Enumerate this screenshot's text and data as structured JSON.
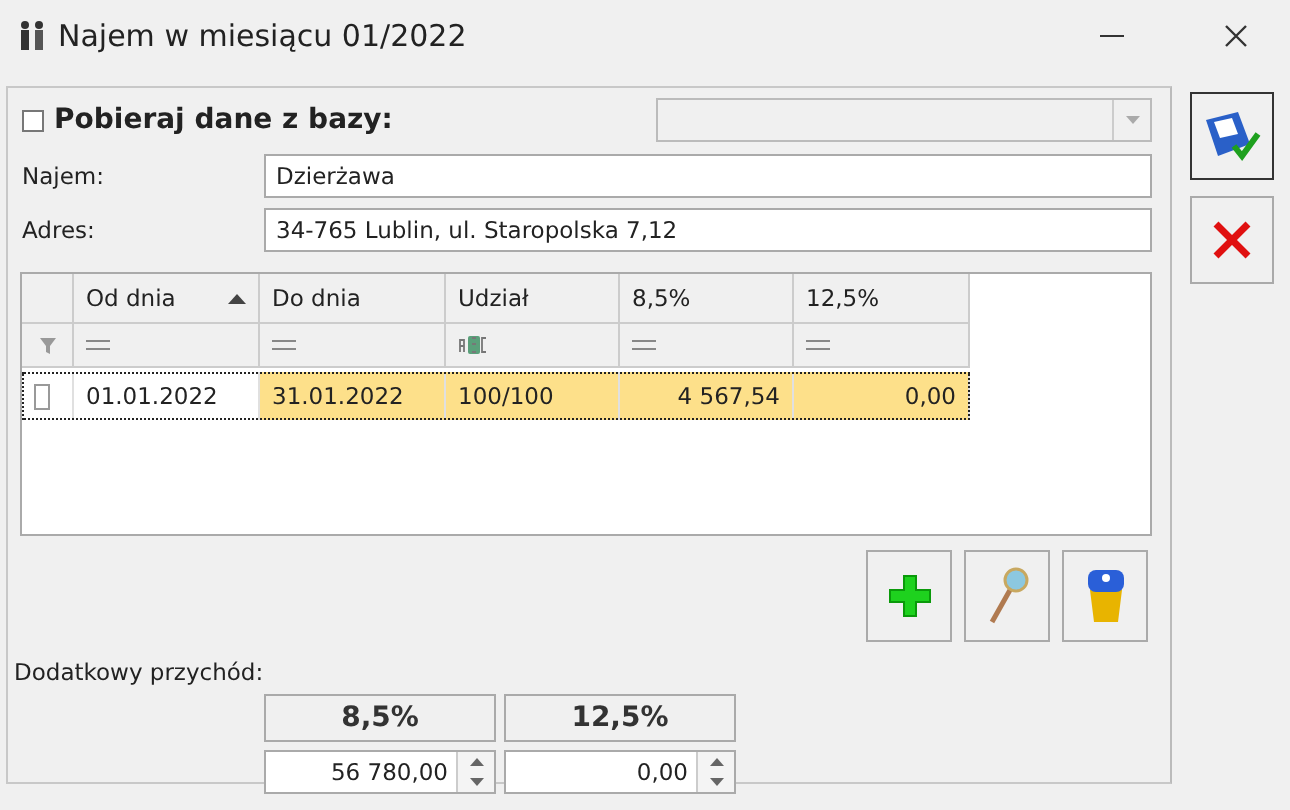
{
  "window": {
    "title": "Najem w miesiącu 01/2022"
  },
  "source": {
    "label": "Pobieraj dane z bazy:",
    "checked": false,
    "disabled": true
  },
  "fields": [
    {
      "label": "Najem:",
      "value": "Dzierżawa"
    },
    {
      "label": "Adres:",
      "value": "34-765 Lublin, ul. Staropolska 7,12"
    }
  ],
  "table": {
    "columns": [
      {
        "label": "Od dnia",
        "sorted": true,
        "kind": "date"
      },
      {
        "label": "Do dnia",
        "sorted": false,
        "kind": "date"
      },
      {
        "label": "Udział",
        "sorted": false,
        "kind": "text"
      },
      {
        "label": "8,5%",
        "sorted": false,
        "kind": "number"
      },
      {
        "label": "12,5%",
        "sorted": false,
        "kind": "number"
      }
    ],
    "rows": [
      {
        "selected": true,
        "checked": false,
        "cells": [
          {
            "text": "01.01.2022",
            "focused": true
          },
          {
            "text": "31.01.2022",
            "focused": false
          },
          {
            "text": "100/100",
            "focused": false
          },
          {
            "text": "4 567,54",
            "focused": false
          },
          {
            "text": "0,00",
            "focused": false
          }
        ]
      }
    ]
  },
  "extra_income": {
    "label": "Dodatkowy przychód:",
    "columns": [
      {
        "header": "8,5%",
        "value": "56 780,00"
      },
      {
        "header": "12,5%",
        "value": "0,00"
      }
    ]
  }
}
